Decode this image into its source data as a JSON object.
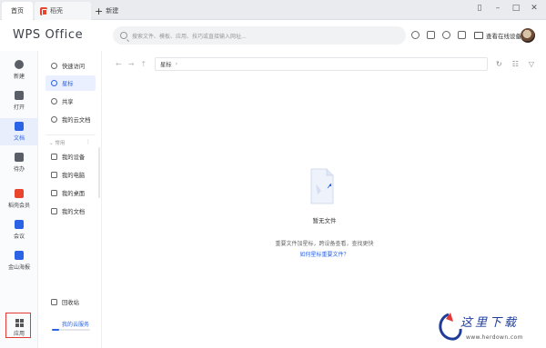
{
  "tabs": {
    "home_label": "首页",
    "shell_label": "稻壳",
    "new_label": "新建"
  },
  "header": {
    "logo": "WPS Office",
    "search_placeholder": "搜索文件、模板、应用、技巧或直接输入网址...",
    "device_label": "查看在线设备"
  },
  "rail": {
    "items": [
      {
        "label": "新建",
        "icon": "plus-circle-icon"
      },
      {
        "label": "打开",
        "icon": "folder-icon"
      },
      {
        "label": "文档",
        "icon": "document-icon"
      },
      {
        "label": "待办",
        "icon": "check-icon"
      },
      {
        "label": "稻壳会员",
        "icon": "docer-icon"
      },
      {
        "label": "会议",
        "icon": "video-icon"
      },
      {
        "label": "金山海报",
        "icon": "poster-icon"
      },
      {
        "label": "应用",
        "icon": "apps-grid-icon"
      }
    ]
  },
  "side": {
    "quick_access": "快速访问",
    "starred": "星标",
    "shared": "共享",
    "my_cloud_docs": "我的云文档",
    "group_label": "常用",
    "my_devices": "我的设备",
    "my_computer": "我的电脑",
    "my_desktop": "我的桌面",
    "my_documents": "我的文档",
    "recycle_bin": "回收站",
    "cloud_service": "我的云服务"
  },
  "main": {
    "breadcrumb": "星标",
    "empty_title": "暂无文件",
    "empty_desc": "重要文件加星标，跨设备查看，查找更快",
    "empty_link": "如何星标重要文件？"
  },
  "watermark": {
    "text": "这里下载",
    "url": "www.herdown.com"
  },
  "colors": {
    "accent": "#2b63e6",
    "brand_red": "#e8442e"
  }
}
